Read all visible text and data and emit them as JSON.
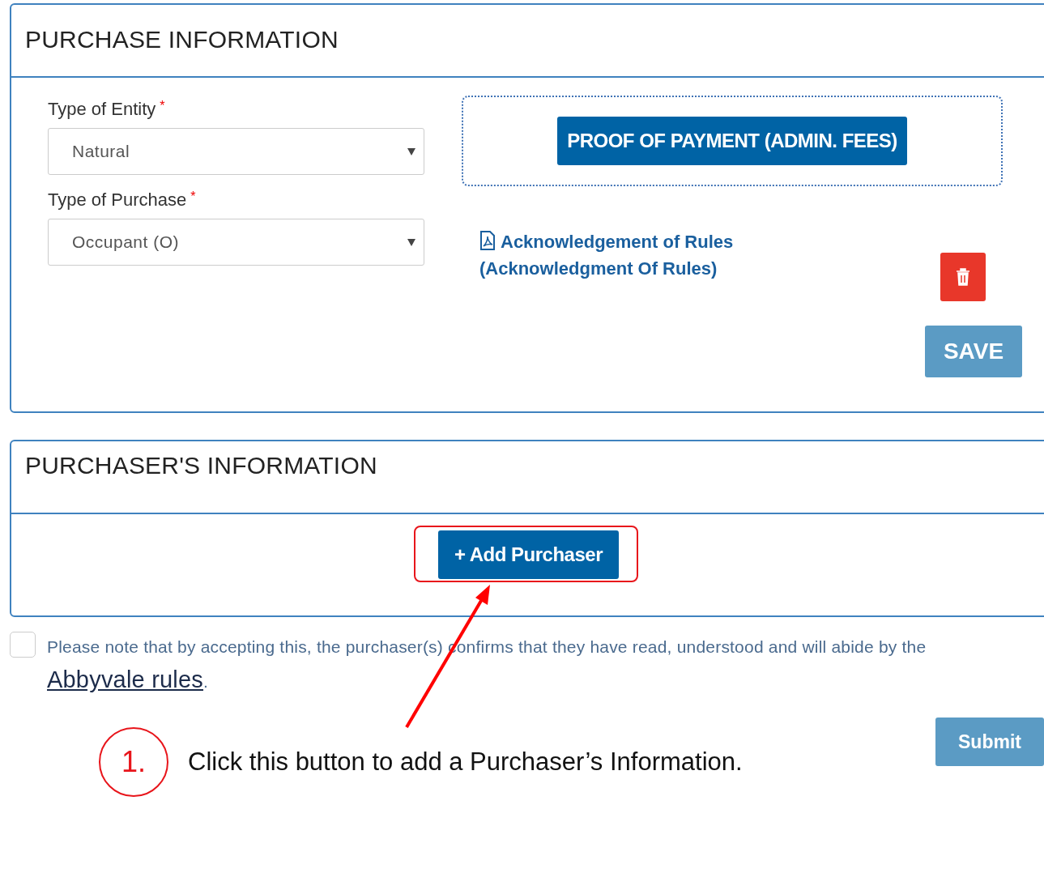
{
  "purchase_information": {
    "title": "PURCHASE INFORMATION",
    "fields": [
      {
        "label": "Type of Entity",
        "required_mark": "*",
        "value": "Natural"
      },
      {
        "label": "Type of Purchase",
        "required_mark": "*",
        "value": "Occupant (O)"
      }
    ],
    "upload_button": "PROOF OF PAYMENT (ADMIN. FEES)",
    "document": {
      "title": "Acknowledgement of Rules",
      "subtitle": "(Acknowledgment Of Rules)"
    },
    "save_button": "SAVE"
  },
  "purchasers_information": {
    "title": "PURCHASER'S INFORMATION",
    "add_button": "+ Add Purchaser"
  },
  "agreement": {
    "checked": false,
    "text_before": "Please note that by accepting this, the purchaser(s) confirms that they have read, understood and will abide by the ",
    "link": "Abbyvale rules",
    "text_after": "."
  },
  "submit_button": "Submit",
  "annotation": {
    "step": "1.",
    "caption": "Click this button to add a Purchaser’s Information."
  }
}
